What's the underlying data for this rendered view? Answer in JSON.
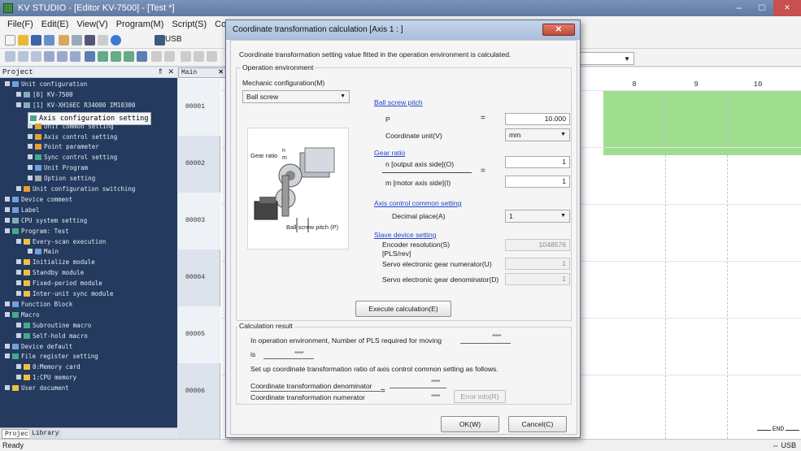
{
  "app": {
    "title": "KV STUDIO - [Editor KV-7500] - [Test *]",
    "window_controls": [
      "–",
      "□",
      "×"
    ]
  },
  "menu": [
    "File(F)",
    "Edit(E)",
    "View(V)",
    "Program(M)",
    "Script(S)",
    "Convert(A"
  ],
  "toolbar": {
    "usb_label": "USB"
  },
  "project": {
    "header": "Project",
    "pin": "⇑ ✕",
    "tree": [
      {
        "label": "Unit configuration",
        "lvl": 0,
        "icon": "#6fa0d8"
      },
      {
        "label": "[0] KV-7500",
        "lvl": 1,
        "icon": "#8ab"
      },
      {
        "label": "[1] KV-XH16EC  R34000  IM10300",
        "lvl": 1,
        "icon": "#8ab"
      },
      {
        "label": "Axis configuration setting",
        "lvl": 2,
        "icon": "#4a8",
        "selected": true
      },
      {
        "label": "Unit common setting",
        "lvl": 2,
        "icon": "#e8a030"
      },
      {
        "label": "Axis control setting",
        "lvl": 2,
        "icon": "#e8a030"
      },
      {
        "label": "Point parameter",
        "lvl": 2,
        "icon": "#e8a030"
      },
      {
        "label": "Sync control setting",
        "lvl": 2,
        "icon": "#4a8"
      },
      {
        "label": "Unit Program",
        "lvl": 2,
        "icon": "#6fa0d8"
      },
      {
        "label": "Option setting",
        "lvl": 2,
        "icon": "#aaa"
      },
      {
        "label": "Unit configuration switching",
        "lvl": 1,
        "icon": "#e8a030"
      },
      {
        "label": "Device comment",
        "lvl": 0,
        "icon": "#6fa0d8"
      },
      {
        "label": "Label",
        "lvl": 0,
        "icon": "#6fa0d8"
      },
      {
        "label": "CPU system setting",
        "lvl": 0,
        "icon": "#8ab"
      },
      {
        "label": "Program: Test",
        "lvl": 0,
        "icon": "#4a8"
      },
      {
        "label": "Every-scan execution",
        "lvl": 1,
        "icon": "#f0c040"
      },
      {
        "label": "Main",
        "lvl": 2,
        "icon": "#6fa0d8"
      },
      {
        "label": "Initialize module",
        "lvl": 1,
        "icon": "#f0c040"
      },
      {
        "label": "Standby module",
        "lvl": 1,
        "icon": "#f0c040"
      },
      {
        "label": "Fixed-period module",
        "lvl": 1,
        "icon": "#f0c040"
      },
      {
        "label": "Inter-unit sync module",
        "lvl": 1,
        "icon": "#f0c040"
      },
      {
        "label": "Function Block",
        "lvl": 0,
        "icon": "#6fa0d8"
      },
      {
        "label": "Macro",
        "lvl": 0,
        "icon": "#4a8"
      },
      {
        "label": "Subroutine macro",
        "lvl": 1,
        "icon": "#4a8"
      },
      {
        "label": "Self-hold macro",
        "lvl": 1,
        "icon": "#4a8"
      },
      {
        "label": "Device default",
        "lvl": 0,
        "icon": "#6fa0d8"
      },
      {
        "label": "File register setting",
        "lvl": 0,
        "icon": "#4a8"
      },
      {
        "label": "0:Memory card",
        "lvl": 1,
        "icon": "#f0c040"
      },
      {
        "label": "1:CPU memory",
        "lvl": 1,
        "icon": "#f0c040"
      },
      {
        "label": "User document",
        "lvl": 0,
        "icon": "#f0c040"
      }
    ],
    "tabs": {
      "project": "Project",
      "library": "Library"
    }
  },
  "editor": {
    "tab": "Main",
    "tab_close": "✕",
    "rows": [
      "00001",
      "00002",
      "00003",
      "00004",
      "00005",
      "00006"
    ],
    "columns": [
      "8",
      "9",
      "10"
    ],
    "end_label": "END"
  },
  "status": {
    "left": "Ready",
    "right": "⇔ USB"
  },
  "dialog": {
    "title": "Coordinate transformation calculation [Axis 1 : ]",
    "close": "✕",
    "intro": "Coordinate transformation setting value fitted in the operation environment is calculated.",
    "op_env_label": "Operation environment",
    "mech_label": "Mechanic configuration(M)",
    "mech_value": "Ball screw",
    "illus": {
      "gear_ratio": "Gear ratio",
      "ratio_n": "n",
      "ratio_m": "m",
      "ball_screw": "Ball screw pitch (P)"
    },
    "ball_screw_pitch_link": "Ball screw pitch",
    "p_label": "P",
    "p_value": "10.000",
    "coord_unit_label": "Coordinate unit(V)",
    "coord_unit_value": "mm",
    "gear_ratio_link": "Gear ratio",
    "n_label": "n [output axis side](O)",
    "n_value": "1",
    "m_label": "m [motor axis side](I)",
    "m_value": "1",
    "axis_common_link": "Axis control common setting",
    "decimal_label": "Decimal place(A)",
    "decimal_value": "1",
    "slave_link": "Slave device setting",
    "encoder_label": "Encoder resolution(S)",
    "encoder_unit": "[PLS/rev]",
    "encoder_value": "1048576",
    "servo_num_label": "Servo electronic gear numerator(U)",
    "servo_num_value": "1",
    "servo_den_label": "Servo electronic gear denominator(D)",
    "servo_den_value": "1",
    "execute_button": "Execute calculation(E)",
    "calc_result_label": "Calculation result",
    "result_line1": "In operation environment, Number of PLS required for moving",
    "result_mask1": "*****",
    "result_is": "is",
    "result_mask2": "*****",
    "result_line2": "Set up coordinate transformation ratio of axis control common setting as follows.",
    "denominator_label": "Coordinate transformation denominator",
    "denominator_mask": "*****",
    "numerator_label": "Coordinate transformation numerator",
    "numerator_mask": "*****",
    "error_info_button": "Error info(R)",
    "ok_button": "OK(W)",
    "cancel_button": "Cancel(C)",
    "eq": "="
  }
}
